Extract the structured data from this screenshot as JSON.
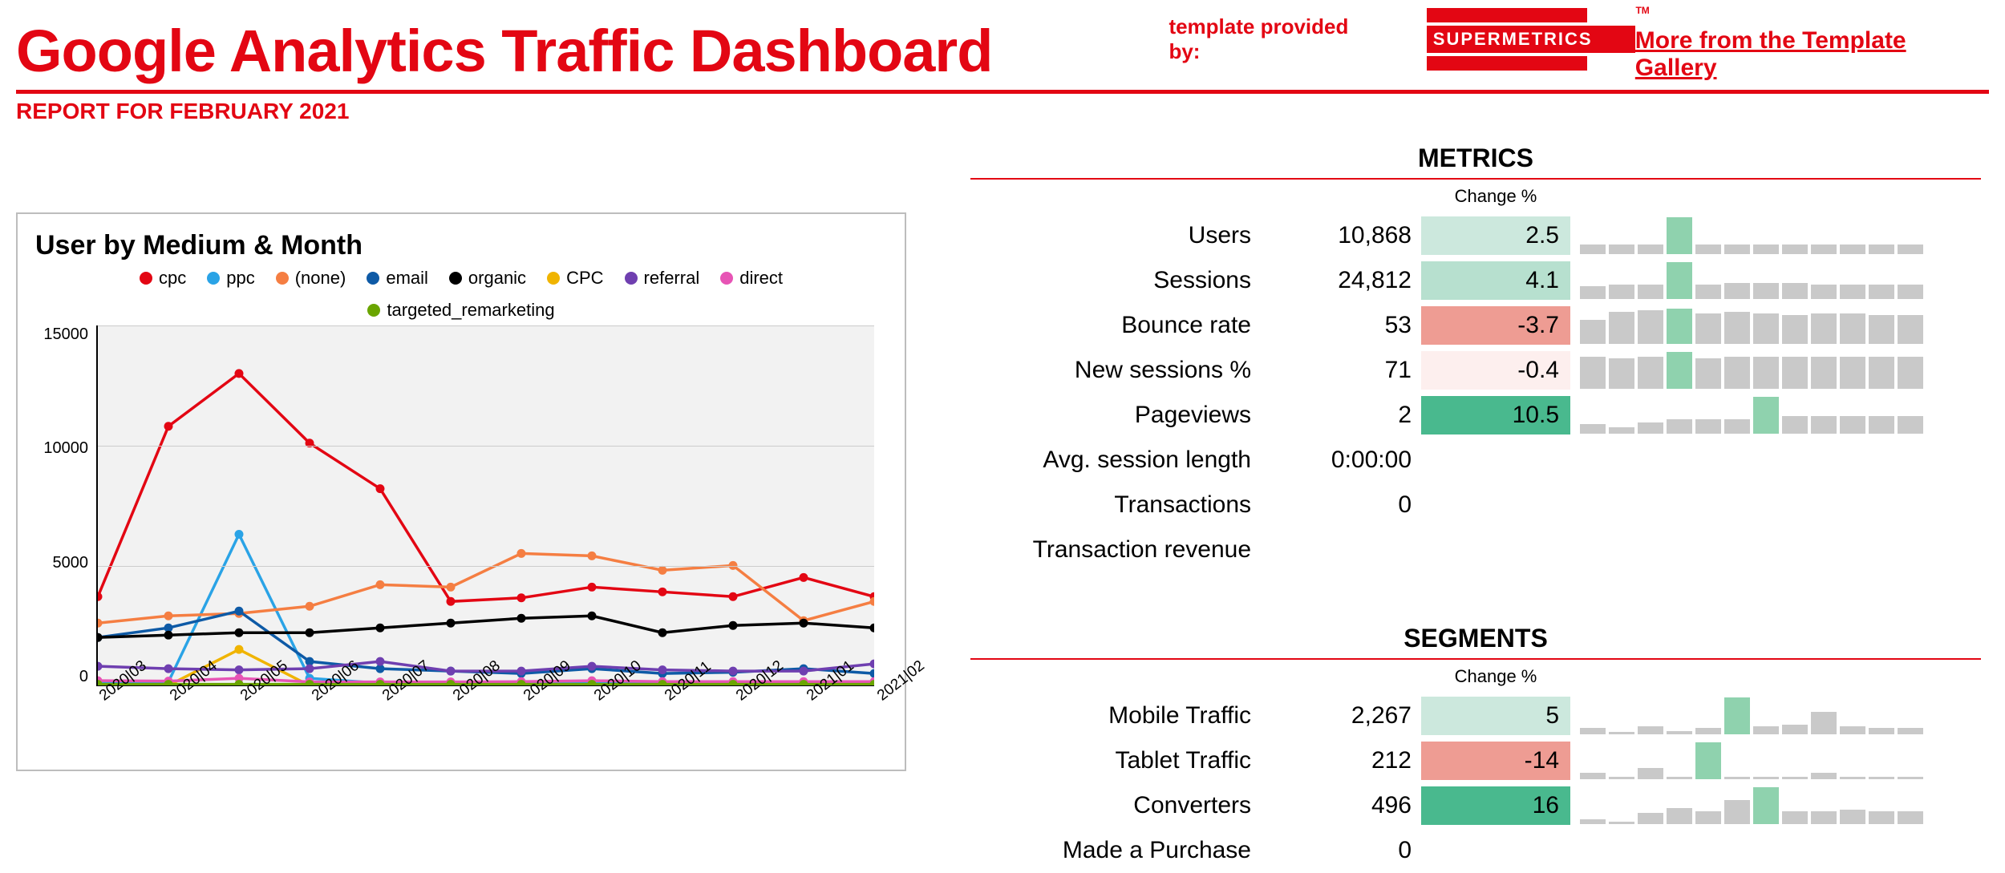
{
  "header": {
    "title": "Google Analytics Traffic Dashboard",
    "provided_by": "template provided by:",
    "logo_text": "SUPERMETRICS",
    "gallery_link": "More from the Template Gallery",
    "subtitle": "REPORT FOR FEBRUARY 2021"
  },
  "chart_title": "User by Medium & Month",
  "metrics": {
    "heading": "METRICS",
    "change_label": "Change %",
    "rows": [
      {
        "label": "Users",
        "value": "10,868",
        "change": 2.5,
        "bg": "#cce8dd",
        "spark": [
          12,
          12,
          12,
          46,
          12,
          12,
          12,
          12,
          12,
          12,
          12,
          12
        ]
      },
      {
        "label": "Sessions",
        "value": "24,812",
        "change": 4.1,
        "bg": "#b7e0cf",
        "spark": [
          16,
          18,
          18,
          46,
          18,
          20,
          20,
          20,
          18,
          18,
          18,
          18
        ]
      },
      {
        "label": "Bounce rate",
        "value": "53",
        "change": -3.7,
        "bg": "#ee9c93",
        "spark": [
          30,
          40,
          42,
          44,
          38,
          40,
          38,
          36,
          38,
          38,
          36,
          36
        ]
      },
      {
        "label": "New sessions %",
        "value": "71",
        "change": -0.4,
        "bg": "#fdefee",
        "spark": [
          40,
          38,
          40,
          46,
          38,
          40,
          40,
          40,
          40,
          40,
          40,
          40
        ]
      },
      {
        "label": "Pageviews",
        "value": "2",
        "change": 10.5,
        "bg": "#49b98e",
        "spark": [
          12,
          8,
          14,
          18,
          18,
          18,
          46,
          22,
          22,
          22,
          22,
          22
        ]
      },
      {
        "label": "Avg. session length",
        "value": "0:00:00",
        "change": null,
        "bg": null,
        "spark": null
      },
      {
        "label": "Transactions",
        "value": "0",
        "change": null,
        "bg": null,
        "spark": null
      },
      {
        "label": "Transaction revenue",
        "value": "",
        "change": null,
        "bg": null,
        "spark": null
      }
    ]
  },
  "segments": {
    "heading": "SEGMENTS",
    "change_label": "Change %",
    "rows": [
      {
        "label": "Mobile Traffic",
        "value": "2,267",
        "change": 5,
        "bg": "#cce8dd",
        "spark": [
          8,
          3,
          10,
          4,
          8,
          46,
          10,
          12,
          28,
          10,
          8,
          8
        ]
      },
      {
        "label": "Tablet Traffic",
        "value": "212",
        "change": -14,
        "bg": "#ee9c93",
        "spark": [
          8,
          3,
          14,
          3,
          46,
          3,
          3,
          3,
          8,
          3,
          3,
          3
        ]
      },
      {
        "label": "Converters",
        "value": "496",
        "change": 16,
        "bg": "#49b98e",
        "spark": [
          6,
          3,
          14,
          20,
          16,
          30,
          46,
          16,
          16,
          18,
          16,
          16
        ]
      },
      {
        "label": "Made a Purchase",
        "value": "0",
        "change": null,
        "bg": null,
        "spark": null
      }
    ]
  },
  "chart_data": {
    "type": "line",
    "title": "User by Medium & Month",
    "xlabel": "",
    "ylabel": "",
    "ylim": [
      0,
      15000
    ],
    "y_ticks": [
      15000,
      10000,
      5000,
      0
    ],
    "categories": [
      "2020|03",
      "2020|04",
      "2020|05",
      "2020|06",
      "2020|07",
      "2020|08",
      "2020|09",
      "2020|10",
      "2020|11",
      "2020|12",
      "2021|01",
      "2021|02"
    ],
    "series": [
      {
        "name": "cpc",
        "color": "#e30613",
        "values": [
          3700,
          10800,
          13000,
          10100,
          8200,
          3500,
          3650,
          4100,
          3900,
          3700,
          4500,
          3700
        ]
      },
      {
        "name": "ppc",
        "color": "#2aa3e6",
        "values": [
          100,
          150,
          6300,
          300,
          100,
          100,
          100,
          100,
          100,
          100,
          100,
          100
        ]
      },
      {
        "name": "(none)",
        "color": "#f57e42",
        "values": [
          2600,
          2900,
          3000,
          3300,
          4200,
          4100,
          5500,
          5400,
          4800,
          5000,
          2700,
          3500
        ]
      },
      {
        "name": "email",
        "color": "#0e5aa6",
        "values": [
          2000,
          2400,
          3100,
          1000,
          700,
          600,
          500,
          700,
          500,
          550,
          700,
          500
        ]
      },
      {
        "name": "organic",
        "color": "#000000",
        "values": [
          2000,
          2100,
          2200,
          2200,
          2400,
          2600,
          2800,
          2900,
          2200,
          2500,
          2600,
          2400
        ]
      },
      {
        "name": "CPC",
        "color": "#f0b400",
        "values": [
          0,
          0,
          1500,
          0,
          0,
          0,
          0,
          0,
          0,
          0,
          0,
          0
        ]
      },
      {
        "name": "referral",
        "color": "#6f3fb0",
        "values": [
          800,
          700,
          650,
          700,
          1000,
          600,
          600,
          800,
          650,
          600,
          600,
          900
        ]
      },
      {
        "name": "direct",
        "color": "#e754b5",
        "values": [
          200,
          180,
          300,
          150,
          150,
          150,
          160,
          200,
          160,
          160,
          160,
          160
        ]
      },
      {
        "name": "targeted_remarketing",
        "color": "#6aa500",
        "values": [
          50,
          50,
          50,
          50,
          50,
          50,
          50,
          50,
          50,
          50,
          50,
          50
        ]
      }
    ]
  }
}
